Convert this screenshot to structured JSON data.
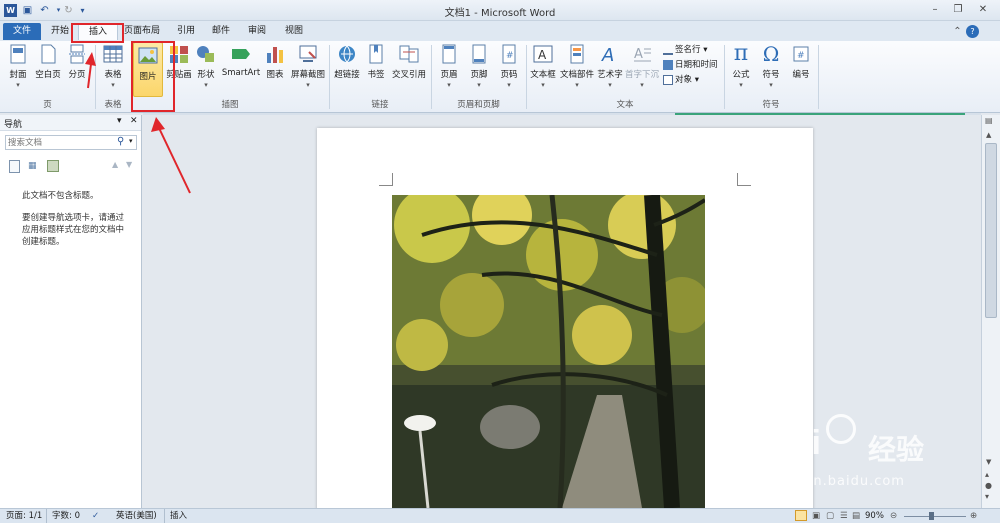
{
  "window": {
    "title": "文档1 - Microsoft Word"
  },
  "tabs": [
    "文件",
    "开始",
    "插入",
    "页面布局",
    "引用",
    "邮件",
    "审阅",
    "视图"
  ],
  "ribbon": {
    "buttons": [
      {
        "label": "封面",
        "icon": "cover-page-icon",
        "dropdown": true
      },
      {
        "label": "空白页",
        "icon": "blank-page-icon"
      },
      {
        "label": "分页",
        "icon": "page-break-icon"
      },
      {
        "label": "表格",
        "icon": "table-icon",
        "dropdown": true
      },
      {
        "label": "图片",
        "icon": "picture-icon"
      },
      {
        "label": "剪贴画",
        "icon": "clip-art-icon"
      },
      {
        "label": "形状",
        "icon": "shapes-icon",
        "dropdown": true
      },
      {
        "label": "SmartArt",
        "icon": "smartart-icon"
      },
      {
        "label": "图表",
        "icon": "chart-icon"
      },
      {
        "label": "屏幕截图",
        "icon": "screenshot-icon",
        "dropdown": true
      },
      {
        "label": "超链接",
        "icon": "hyperlink-icon"
      },
      {
        "label": "书签",
        "icon": "bookmark-icon"
      },
      {
        "label": "交叉引用",
        "icon": "cross-reference-icon"
      },
      {
        "label": "页眉",
        "icon": "header-icon",
        "dropdown": true
      },
      {
        "label": "页脚",
        "icon": "footer-icon",
        "dropdown": true
      },
      {
        "label": "页码",
        "icon": "page-number-icon",
        "dropdown": true
      },
      {
        "label": "文本框",
        "icon": "text-box-icon",
        "dropdown": true
      },
      {
        "label": "文档部件",
        "icon": "quick-parts-icon",
        "dropdown": true
      },
      {
        "label": "艺术字",
        "icon": "wordart-icon",
        "dropdown": true
      },
      {
        "label": "首字下沉",
        "icon": "drop-cap-icon",
        "dropdown": true
      },
      {
        "label": "公式",
        "icon": "equation-icon",
        "dropdown": true
      },
      {
        "label": "符号",
        "icon": "symbol-icon",
        "dropdown": true
      },
      {
        "label": "编号",
        "icon": "number-icon"
      }
    ],
    "small_buttons": [
      "签名行",
      "日期和时间",
      "对象"
    ],
    "groups": [
      "页",
      "表格",
      "插图",
      "链接",
      "页眉和页脚",
      "文本",
      "符号"
    ]
  },
  "navigation": {
    "title": "导航",
    "search_placeholder": "搜索文档",
    "message_line1": "此文档不包含标题。",
    "message_line2": "要创建导航选项卡，请通过应用标题样式在您的文档中创建标题。"
  },
  "status": {
    "page": "页面: 1/1",
    "words": "字数: 0",
    "language": "英语(美国)",
    "mode": "插入",
    "zoom": "90%"
  },
  "watermark": {
    "brand": "Bai",
    "brand2": "经验",
    "url": "jingyan.baidu.com"
  },
  "colors": {
    "accent": "#2b6cb8",
    "highlight": "#e0262b"
  }
}
